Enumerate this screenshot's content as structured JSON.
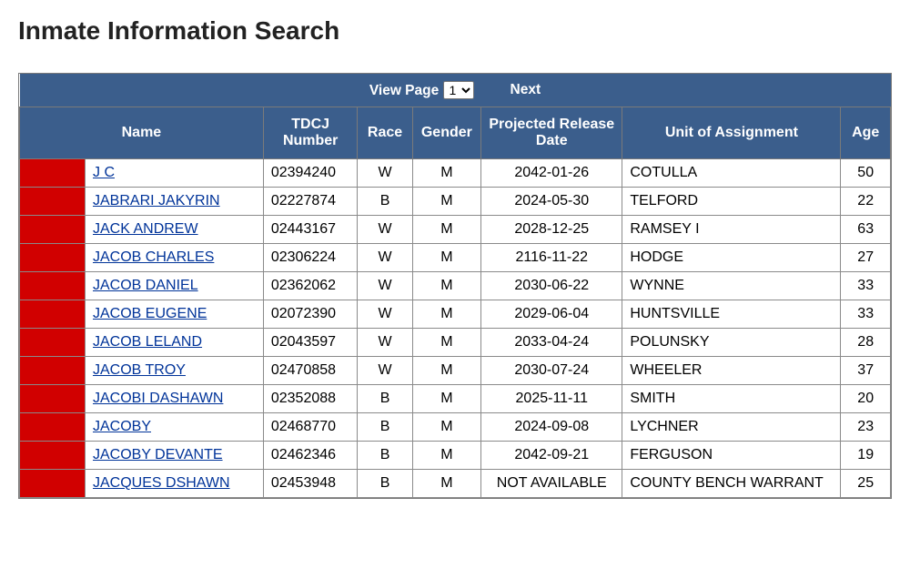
{
  "title": "Inmate Information Search",
  "pager": {
    "view_page_label": "View Page",
    "selected_page": "1",
    "next_label": "Next"
  },
  "columns": {
    "name": "Name",
    "tdcj": "TDCJ Number",
    "race": "Race",
    "gender": "Gender",
    "release": "Projected Release Date",
    "unit": "Unit of Assignment",
    "age": "Age"
  },
  "rows": [
    {
      "name": "J C",
      "tdcj": "02394240",
      "race": "W",
      "gender": "M",
      "release": "2042-01-26",
      "unit": "COTULLA",
      "age": "50"
    },
    {
      "name": "JABRARI JAKYRIN",
      "tdcj": "02227874",
      "race": "B",
      "gender": "M",
      "release": "2024-05-30",
      "unit": "TELFORD",
      "age": "22"
    },
    {
      "name": "JACK ANDREW",
      "tdcj": "02443167",
      "race": "W",
      "gender": "M",
      "release": "2028-12-25",
      "unit": "RAMSEY I",
      "age": "63"
    },
    {
      "name": "JACOB CHARLES",
      "tdcj": "02306224",
      "race": "W",
      "gender": "M",
      "release": "2116-11-22",
      "unit": "HODGE",
      "age": "27"
    },
    {
      "name": "JACOB DANIEL",
      "tdcj": "02362062",
      "race": "W",
      "gender": "M",
      "release": "2030-06-22",
      "unit": "WYNNE",
      "age": "33"
    },
    {
      "name": "JACOB EUGENE",
      "tdcj": "02072390",
      "race": "W",
      "gender": "M",
      "release": "2029-06-04",
      "unit": "HUNTSVILLE",
      "age": "33"
    },
    {
      "name": "JACOB LELAND",
      "tdcj": "02043597",
      "race": "W",
      "gender": "M",
      "release": "2033-04-24",
      "unit": "POLUNSKY",
      "age": "28"
    },
    {
      "name": "JACOB TROY",
      "tdcj": "02470858",
      "race": "W",
      "gender": "M",
      "release": "2030-07-24",
      "unit": "WHEELER",
      "age": "37"
    },
    {
      "name": "JACOBI DASHAWN",
      "tdcj": "02352088",
      "race": "B",
      "gender": "M",
      "release": "2025-11-11",
      "unit": "SMITH",
      "age": "20"
    },
    {
      "name": "JACOBY",
      "tdcj": "02468770",
      "race": "B",
      "gender": "M",
      "release": "2024-09-08",
      "unit": "LYCHNER",
      "age": "23"
    },
    {
      "name": "JACOBY DEVANTE",
      "tdcj": "02462346",
      "race": "B",
      "gender": "M",
      "release": "2042-09-21",
      "unit": "FERGUSON",
      "age": "19"
    },
    {
      "name": "JACQUES DSHAWN",
      "tdcj": "02453948",
      "race": "B",
      "gender": "M",
      "release": "NOT AVAILABLE",
      "unit": "COUNTY BENCH WARRANT",
      "age": "25"
    }
  ]
}
